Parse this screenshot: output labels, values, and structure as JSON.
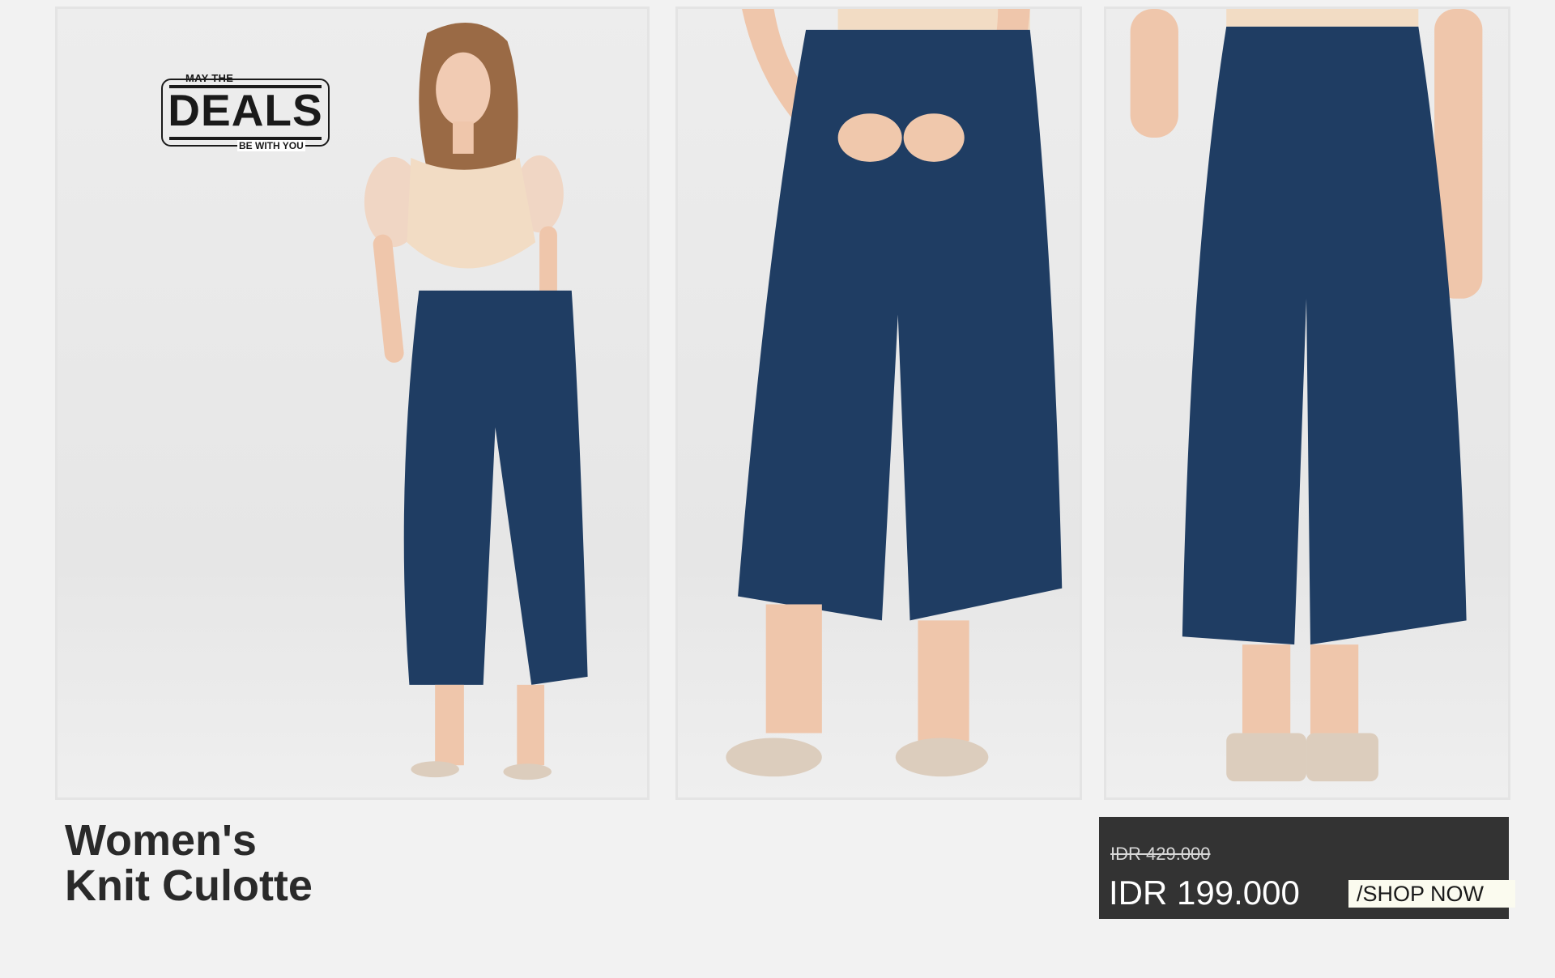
{
  "logo": {
    "top_text": "MAY THE",
    "word": "DEALS",
    "bottom_text": "BE WITH YOU"
  },
  "product": {
    "title_line1": "Women's",
    "title_line2": "Knit Culotte"
  },
  "price": {
    "original": "IDR 429.000",
    "sale": "IDR 199.000"
  },
  "cta": {
    "label": "/SHOP NOW"
  },
  "colors": {
    "pants": "#1f3d63",
    "top": "#f2dcc4",
    "price_box": "#333333",
    "background": "#f2f2f2"
  }
}
